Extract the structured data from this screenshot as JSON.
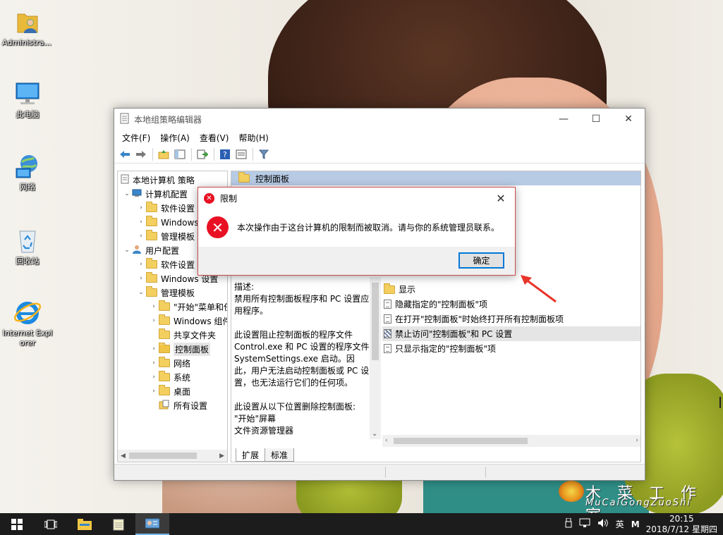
{
  "desktop": {
    "icons": [
      {
        "label": "Administra..."
      },
      {
        "label": "此电脑"
      },
      {
        "label": "网络"
      },
      {
        "label": "回收站"
      },
      {
        "label": "Internet Explorer"
      }
    ]
  },
  "window": {
    "title": "本地组策略编辑器",
    "controls": {
      "minimize": "—",
      "maximize": "☐",
      "close": "✕"
    },
    "menu": [
      "文件(F)",
      "操作(A)",
      "查看(V)",
      "帮助(H)"
    ],
    "tree": {
      "root": "本地计算机 策略",
      "items": [
        {
          "label": "计算机配置",
          "level": 1
        },
        {
          "label": "软件设置",
          "level": 2
        },
        {
          "label": "Windows 设置",
          "level": 2
        },
        {
          "label": "管理模板",
          "level": 2
        },
        {
          "label": "用户配置",
          "level": 1
        },
        {
          "label": "软件设置",
          "level": 2
        },
        {
          "label": "Windows 设置",
          "level": 2
        },
        {
          "label": "管理模板",
          "level": 2
        },
        {
          "label": "\"开始\"菜单和任务栏",
          "level": 3
        },
        {
          "label": "Windows 组件",
          "level": 3
        },
        {
          "label": "共享文件夹",
          "level": 3
        },
        {
          "label": "控制面板",
          "level": 3,
          "selected": true
        },
        {
          "label": "网络",
          "level": 3
        },
        {
          "label": "系统",
          "level": 3
        },
        {
          "label": "桌面",
          "level": 3
        },
        {
          "label": "所有设置",
          "level": 3
        }
      ]
    },
    "right_header": "控制面板",
    "description": {
      "heading": "描述:",
      "paragraphs": [
        [
          "禁用所有控制面板程序和 PC 设置应用程序。"
        ],
        [
          "此设置阻止控制面板的程序文件 Control.exe 和 PC 设置的程序文件 SystemSettings.exe 启动。因此，用户无法启动控制面板或 PC 设置，也无法运行它们的任何项。"
        ],
        [
          "此设置从以下位置删除控制面板:",
          "\"开始\"屏幕",
          "文件资源管理器"
        ]
      ]
    },
    "list": [
      {
        "label": "显示",
        "type": "folder"
      },
      {
        "label": "隐藏指定的\"控制面板\"项",
        "type": "setting"
      },
      {
        "label": "在打开\"控制面板\"时始终打开所有控制面板项",
        "type": "setting"
      },
      {
        "label": "禁止访问\"控制面板\"和 PC 设置",
        "type": "setting",
        "selected": true
      },
      {
        "label": "只显示指定的\"控制面板\"项",
        "type": "setting"
      }
    ],
    "tabs": [
      "扩展",
      "标准"
    ]
  },
  "dialog": {
    "title": "限制",
    "message": "本次操作由于这台计算机的限制而被取消。请与你的系统管理员联系。",
    "ok_label": "确定",
    "close_label": "✕"
  },
  "watermark": {
    "line1": "木 菜 工 作 室",
    "line2": "MuCaiGongZuoShi"
  },
  "taskbar": {
    "ime": "英",
    "ime_mode": "M",
    "time": "20:15",
    "date": "2018/7/12 星期四"
  },
  "colors": {
    "selection": "#b7cbe5",
    "error": "#e81123",
    "taskbar": "#1c1c1c",
    "ok_border": "#0078d7"
  }
}
